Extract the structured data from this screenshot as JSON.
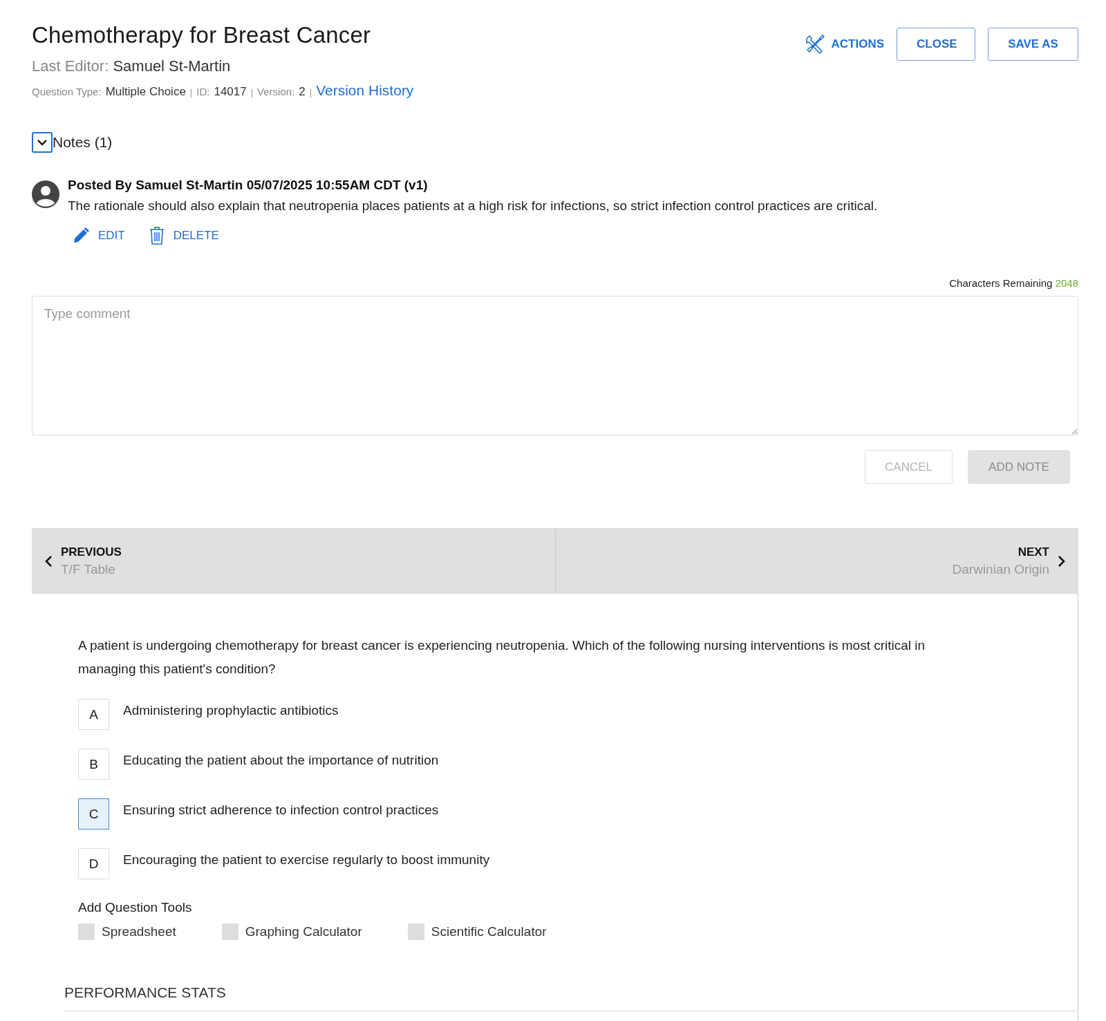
{
  "header": {
    "title": "Chemotherapy for Breast Cancer",
    "last_editor_label": "Last Editor:",
    "last_editor": "Samuel St-Martin",
    "meta": [
      {
        "label": "Question Type:",
        "value": "Multiple Choice"
      },
      {
        "label": "ID:",
        "value": "14017"
      },
      {
        "label": "Version:",
        "value": "2"
      }
    ],
    "separator": "|",
    "version_history_link": "Version History"
  },
  "toolbar": {
    "actions": "ACTIONS",
    "buttons": [
      "CLOSE",
      "SAVE AS"
    ]
  },
  "notes": {
    "toggle_label": "Notes (1)",
    "expanded": true,
    "items": [
      {
        "posted": "Posted By Samuel St-Martin 05/07/2025 10:55AM CDT (v1)",
        "text": "The rationale should also explain that neutropenia places patients at a high risk for infections, so strict infection control practices are critical.",
        "edit": "EDIT",
        "delete": "DELETE"
      }
    ],
    "characters_remaining_label": "Characters Remaining",
    "characters_remaining": "2048",
    "comment_field": {
      "placeholder": "Type comment"
    },
    "buttons": [
      {
        "kind": "outline",
        "label": "CANCEL",
        "disabled": true
      },
      {
        "kind": "filled",
        "label": "ADD NOTE",
        "disabled": true
      }
    ]
  },
  "navigation": {
    "previous": {
      "label": "PREVIOUS",
      "title": "T/F Table"
    },
    "next": {
      "label": "NEXT",
      "title": "Darwinian Origin"
    }
  },
  "question": {
    "stem": " A patient is undergoing chemotherapy for breast cancer is experiencing neutropenia. Which of the following nursing interventions is most critical in managing this patient's condition?",
    "choices": [
      {
        "letter": "A",
        "text": "Administering prophylactic antibiotics",
        "selected": false
      },
      {
        "letter": "B",
        "text": "Educating the patient about the importance of nutrition",
        "selected": false
      },
      {
        "letter": "C",
        "text": "Ensuring strict adherence to infection control practices",
        "selected": true
      },
      {
        "letter": "D",
        "text": "Encouraging the patient to exercise regularly to boost immunity",
        "selected": false
      }
    ],
    "tools_heading": "Add Question Tools",
    "tools": [
      {
        "label": "Spreadsheet",
        "checked": false
      },
      {
        "label": "Graphing Calculator",
        "checked": false
      },
      {
        "label": "Scientific Calculator",
        "checked": false
      }
    ],
    "performance_heading": "PERFORMANCE STATS"
  }
}
